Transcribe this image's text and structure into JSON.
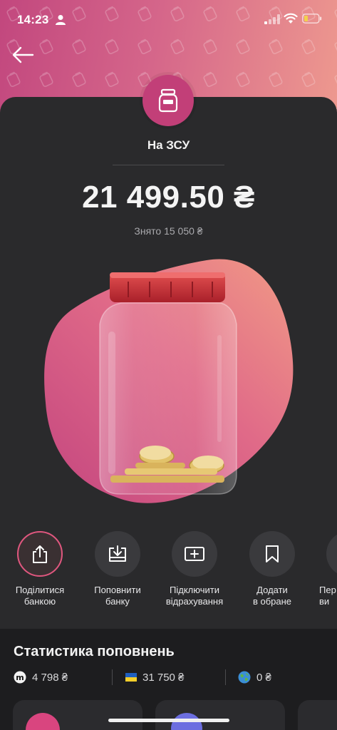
{
  "status_bar": {
    "time": "14:23"
  },
  "jar": {
    "name": "На ЗСУ",
    "balance": "21 499.50 ₴",
    "withdrawn": "Знято 15 050 ₴"
  },
  "actions": [
    {
      "label": "Поділитися\nбанкою",
      "icon": "share-icon"
    },
    {
      "label": "Поповнити\nбанку",
      "icon": "top-up-icon"
    },
    {
      "label": "Підключити\nвідрахування",
      "icon": "add-deduction-icon"
    },
    {
      "label": "Додати\nв обране",
      "icon": "bookmark-icon"
    },
    {
      "label": "Пер\nви",
      "icon": "more-icon"
    }
  ],
  "stats": {
    "title": "Статистика поповнень",
    "sources": [
      {
        "icon": "monobank-icon",
        "value": "4 798 ₴"
      },
      {
        "icon": "ukraine-flag-icon",
        "value": "31 750 ₴"
      },
      {
        "icon": "globe-icon",
        "value": "0 ₴"
      }
    ]
  },
  "colors": {
    "accent": "#c23f78",
    "gradient_start": "#c2477e",
    "gradient_end": "#ee9a8f",
    "card_bg": "#2a2a2c"
  }
}
